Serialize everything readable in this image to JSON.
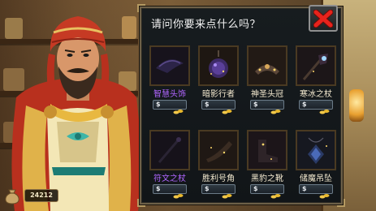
{
  "shop": {
    "title": "请问你要来点什么吗？",
    "close_icon": "close-x-icon",
    "items": [
      {
        "name": "智慧头饰",
        "price_symbol": "$",
        "rare": true,
        "icon": "dark-headband-icon",
        "color": "#2a2440"
      },
      {
        "name": "暗影行者",
        "price_symbol": "$",
        "rare": false,
        "icon": "shadow-orb-amulet-icon",
        "color": "#3d2a66"
      },
      {
        "name": "神圣头冠",
        "price_symbol": "$",
        "rare": false,
        "icon": "holy-crown-icon",
        "color": "#4a3a30"
      },
      {
        "name": "寒冰之杖",
        "price_symbol": "$",
        "rare": false,
        "icon": "frost-staff-icon",
        "color": "#2a2230"
      },
      {
        "name": "符文之杖",
        "price_symbol": "$",
        "rare": true,
        "icon": "rune-staff-icon",
        "color": "#201c26"
      },
      {
        "name": "胜利号角",
        "price_symbol": "$",
        "rare": false,
        "icon": "victory-horn-icon",
        "color": "#2c2420"
      },
      {
        "name": "黑豹之靴",
        "price_symbol": "$",
        "rare": false,
        "icon": "panther-boots-icon",
        "color": "#2a2228"
      },
      {
        "name": "储魔吊坠",
        "price_symbol": "$",
        "rare": false,
        "icon": "mana-pendant-icon",
        "color": "#24304a"
      }
    ]
  },
  "player": {
    "gold": "24212",
    "gold_icon": "money-bag-icon"
  },
  "colors": {
    "panel_bg": "#151a1d",
    "panel_border": "#6d6048",
    "rare_text": "#b066ff",
    "normal_text": "#f4ead0",
    "close_x": "#e8231c"
  }
}
